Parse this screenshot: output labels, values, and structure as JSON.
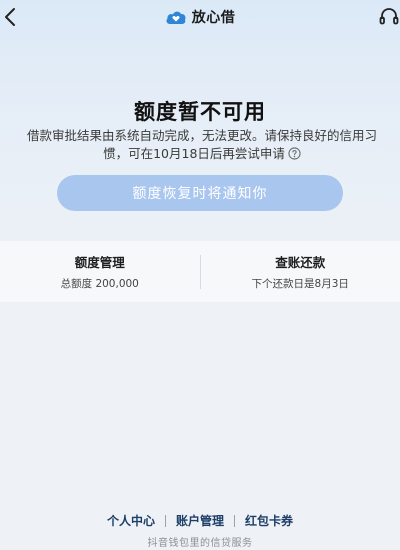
{
  "header": {
    "brand_name": "放心借",
    "brand_color": "#2f86d6"
  },
  "icons": {
    "back": "chevron-left-icon",
    "brand": "cloud-heart-logo",
    "support": "headset-icon",
    "help": "question-circle-icon"
  },
  "status": {
    "title": "额度暂不可用",
    "description": "借款审批结果由系统自动完成，无法更改。请保持良好的信用习惯，可在10月18日后再尝试申请"
  },
  "notify_button": {
    "label": "额度恢复时将通知你",
    "color": "#a9c6ef"
  },
  "cards": [
    {
      "title": "额度管理",
      "subtitle": "总额度 200,000"
    },
    {
      "title": "查账还款",
      "subtitle": "下个还款日是8月3日"
    }
  ],
  "footer": {
    "links": [
      "个人中心",
      "账户管理",
      "红包卡券"
    ],
    "tagline": "抖音钱包里的信贷服务"
  }
}
